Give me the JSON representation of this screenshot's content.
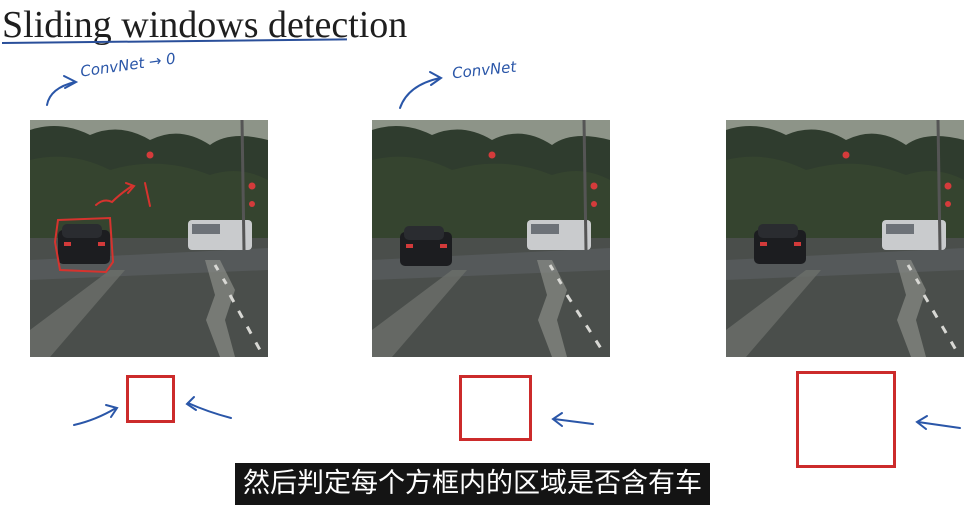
{
  "slide": {
    "title": "Sliding windows detection",
    "annotation_left": "ConvNet → 0",
    "annotation_mid": "ConvNet"
  },
  "subtitle": {
    "text": "然后判定每个方框内的区域是否含有车"
  },
  "colors": {
    "ink_blue": "#2a56a8",
    "window_red": "#cc2b2b",
    "title_text": "#1e1e1e"
  },
  "panels": [
    "road-photo-left",
    "road-photo-middle",
    "road-photo-right"
  ],
  "window_sizes": [
    "small",
    "medium",
    "large"
  ]
}
